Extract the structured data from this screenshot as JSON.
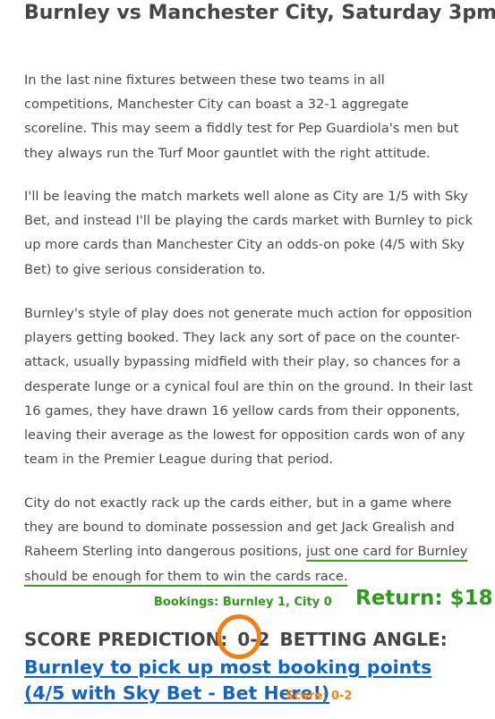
{
  "article": {
    "headline": "Burnley vs Manchester City, Saturday 3pm -",
    "paragraphs": [
      "In the last nine fixtures between these two teams in all competitions, Manchester City can boast a 32-1 aggregate scoreline. This may seem a fiddly test for Pep Guardiola's men but they always run the Turf Moor gauntlet with the right attitude.",
      "I'll be leaving the match markets well alone as City are 1/5 with Sky Bet, and instead I'll be playing the cards market with Burnley to pick up more cards than Manchester City an odds-on poke (4/5 with Sky Bet) to give serious consideration to.",
      "Burnley's style of play does not generate much action for opposition players getting booked. They lack any sort of pace on the counter-attack, usually bypassing midfield with their play, so chances for a desperate lunge or a cynical foul are thin on the ground. In their last 16 games, they have drawn 16 yellow cards from their opponents, leaving their average as the lowest for opposition cards won of any team in the Premier League during that period."
    ],
    "paragraph4_start": "City do not exactly rack up the cards either, but in a game where they are bound to dominate possession and get Jack Grealish and Raheem Sterling into dangerous positions, ",
    "paragraph4_highlight": "just one card for Burnley should be enough for them to win the cards race.",
    "score_prediction_label": "SCORE PREDICTION:",
    "score_prediction_value": "0-2",
    "betting_angle_label": "BETTING ANGLE:",
    "betting_angle_link": "Burnley to pick up most booking points (4/5 with Sky Bet - Bet Here!)"
  },
  "annotations": {
    "bookings": "Bookings: Burnley 1, City 0",
    "return": "Return: $18",
    "score": "Score: 0-2",
    "green": "#2f9a1e",
    "orange": "#f07f16"
  }
}
